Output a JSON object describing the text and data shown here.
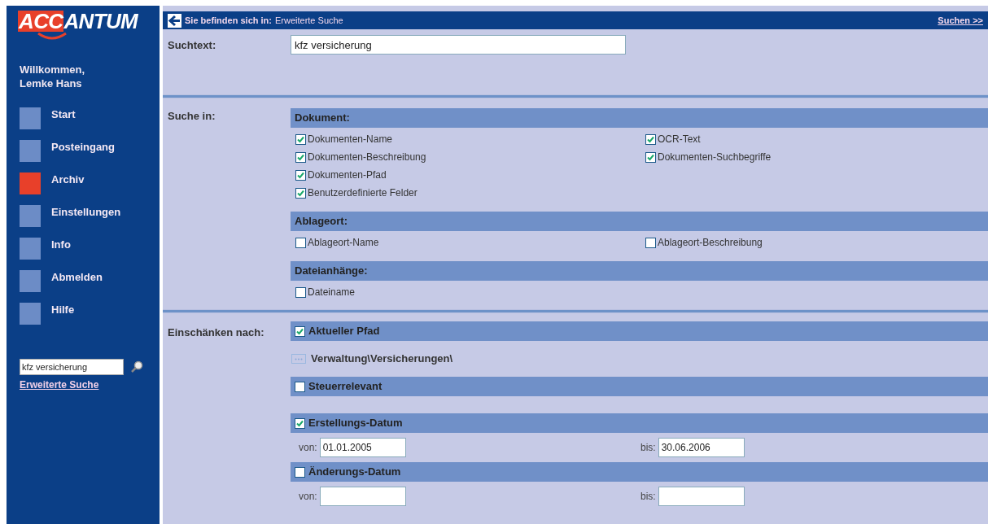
{
  "sidebar": {
    "logo": {
      "prefix": "ACC",
      "suffix": "ANTUM"
    },
    "welcome": [
      "Willkommen,",
      "Lemke Hans"
    ],
    "items": [
      {
        "label": "Start",
        "selected": false
      },
      {
        "label": "Posteingang",
        "selected": false
      },
      {
        "label": "Archiv",
        "selected": true
      },
      {
        "label": "Einstellungen",
        "selected": false
      },
      {
        "label": "Info",
        "selected": false
      },
      {
        "label": "Abmelden",
        "selected": false
      },
      {
        "label": "Hilfe",
        "selected": false
      }
    ],
    "search": {
      "value": "kfz versicherung"
    },
    "advanced_link": "Erweiterte Suche"
  },
  "breadcrumb": {
    "label": "Sie befinden sich in:",
    "current": "Erweiterte Suche"
  },
  "search_link": "Suchen >>",
  "suchtext": {
    "label": "Suchtext:",
    "value": "kfz versicherung"
  },
  "suche_in": {
    "label": "Suche in:",
    "groups": [
      {
        "title": "Dokument:",
        "columns": [
          [
            {
              "label": "Dokumenten-Name",
              "checked": true
            },
            {
              "label": "Dokumenten-Beschreibung",
              "checked": true
            },
            {
              "label": "Dokumenten-Pfad",
              "checked": true
            },
            {
              "label": "Benutzerdefinierte Felder",
              "checked": true
            }
          ],
          [
            {
              "label": "OCR-Text",
              "checked": true
            },
            {
              "label": "Dokumenten-Suchbegriffe",
              "checked": true
            }
          ]
        ]
      },
      {
        "title": "Ablageort:",
        "columns": [
          [
            {
              "label": "Ablageort-Name",
              "checked": false
            }
          ],
          [
            {
              "label": "Ablageort-Beschreibung",
              "checked": false
            }
          ]
        ]
      },
      {
        "title": "Dateianhänge:",
        "columns": [
          [
            {
              "label": "Dateiname",
              "checked": false
            }
          ]
        ]
      }
    ]
  },
  "einschraenken": {
    "label": "Einschänken nach:",
    "filters": [
      {
        "kind": "path",
        "title": "Aktueller Pfad",
        "checked": true,
        "path": "Verwaltung\\Versicherungen\\"
      },
      {
        "kind": "flag",
        "title": "Steuerrelevant",
        "checked": false
      },
      {
        "kind": "date",
        "title": "Erstellungs-Datum",
        "checked": true,
        "from_label": "von:",
        "from": "01.01.2005",
        "to_label": "bis:",
        "to": "30.06.2006"
      },
      {
        "kind": "date",
        "title": "Änderungs-Datum",
        "checked": false,
        "from_label": "von:",
        "to_label": "bis:"
      }
    ]
  }
}
